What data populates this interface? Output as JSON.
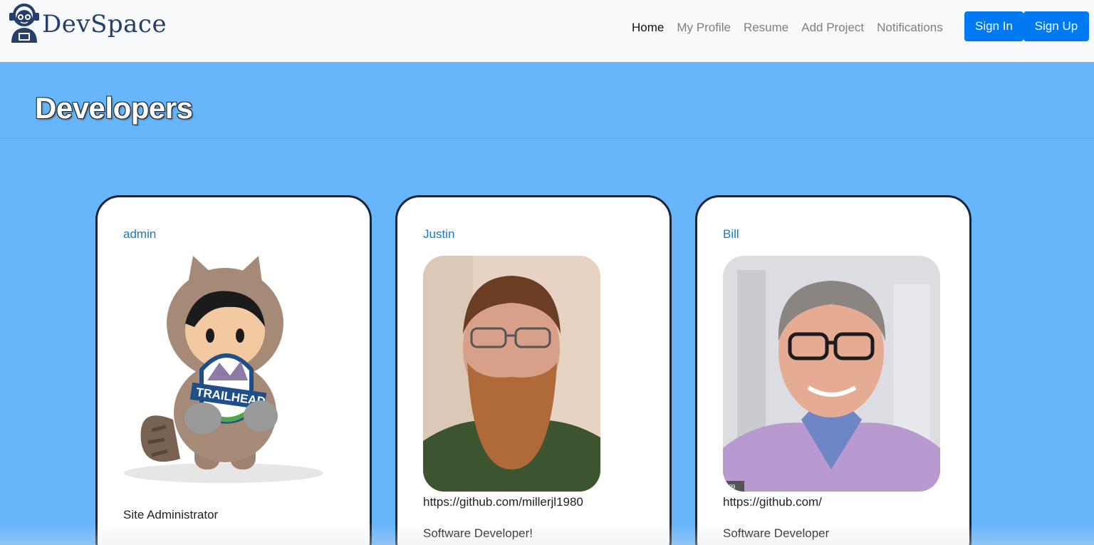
{
  "brand": {
    "name": "DevSpace",
    "logo_icon": "developer-avatar-icon"
  },
  "nav": {
    "links": [
      "Home",
      "My Profile",
      "Resume",
      "Add Project",
      "Notifications"
    ],
    "active": "Home",
    "sign_in": "Sign In",
    "sign_up": "Sign Up"
  },
  "page": {
    "title": "Developers"
  },
  "developers": [
    {
      "name": "admin",
      "description": "Site Administrator",
      "photo": "trailhead-mascot-image"
    },
    {
      "name": "Justin",
      "link": "https://github.com/millerjl1980",
      "description": "Software Developer!",
      "photo": "profile-photo"
    },
    {
      "name": "Bill",
      "link": "https://github.com/",
      "description": "Software Developer",
      "photo": "profile-photo",
      "photo_watermark": "899"
    }
  ],
  "colors": {
    "navbar_bg": "#f8f9fa",
    "page_bg": "#67b5fb",
    "primary_button": "#0079f2",
    "link": "#1a78c8",
    "brand": "#243f6b"
  }
}
